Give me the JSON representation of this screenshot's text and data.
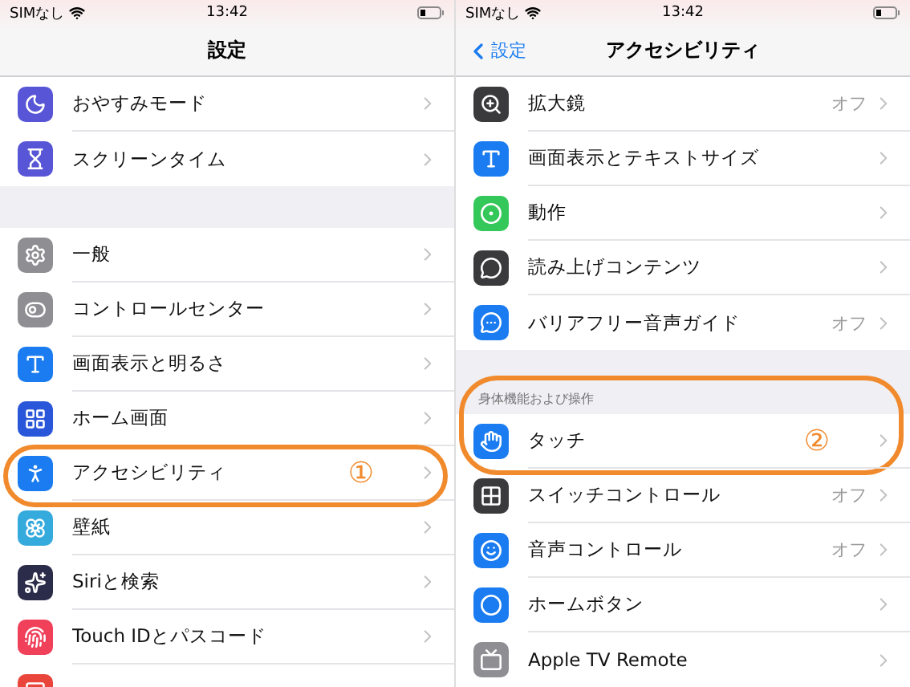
{
  "panels": [
    {
      "status_bar": {
        "carrier": "SIMなし",
        "time": "13:42"
      },
      "nav": {
        "title": "設定"
      },
      "groups": [
        {
          "rows": [
            {
              "label": "おやすみモード",
              "color": "#5856d6"
            },
            {
              "label": "スクリーンタイム",
              "color": "#5856d6"
            }
          ]
        },
        {
          "rows": [
            {
              "label": "一般",
              "color": "#8e8e93"
            },
            {
              "label": "コントロールセンター",
              "color": "#8e8e93"
            },
            {
              "label": "画面表示と明るさ",
              "color": "#1a7cf0"
            },
            {
              "label": "ホーム画面",
              "color": "#2a56d9"
            },
            {
              "label": "アクセシビリティ",
              "color": "#1a7cf0",
              "callout": "①"
            },
            {
              "label": "壁紙",
              "color": "#35aadc"
            },
            {
              "label": "Siriと検索",
              "color": "#2b2b4a"
            },
            {
              "label": "Touch IDとパスコード",
              "color": "#f0405a"
            },
            {
              "color": "#e9453a"
            }
          ]
        }
      ]
    },
    {
      "status_bar": {
        "carrier": "SIMなし",
        "time": "13:42"
      },
      "nav": {
        "back": "設定",
        "title": "アクセシビリティ"
      },
      "groups": [
        {
          "rows": [
            {
              "label": "拡大鏡",
              "value": "オフ",
              "color": "#3a3a3c"
            },
            {
              "label": "画面表示とテキストサイズ",
              "color": "#1a7cf0"
            },
            {
              "label": "動作",
              "color": "#34c759"
            },
            {
              "label": "読み上げコンテンツ",
              "color": "#3a3a3c"
            },
            {
              "label": "バリアフリー音声ガイド",
              "value": "オフ",
              "color": "#1a7cf0"
            }
          ]
        },
        {
          "header": "身体機能および操作",
          "callout": "②",
          "rows": [
            {
              "label": "タッチ",
              "color": "#1a7cf0"
            },
            {
              "label": "スイッチコントロール",
              "value": "オフ",
              "color": "#3a3a3c"
            },
            {
              "label": "音声コントロール",
              "value": "オフ",
              "color": "#1a7cf0"
            },
            {
              "label": "ホームボタン",
              "color": "#1a7cf0"
            },
            {
              "label": "Apple TV Remote",
              "color": "#8e8e93"
            }
          ]
        }
      ]
    }
  ]
}
